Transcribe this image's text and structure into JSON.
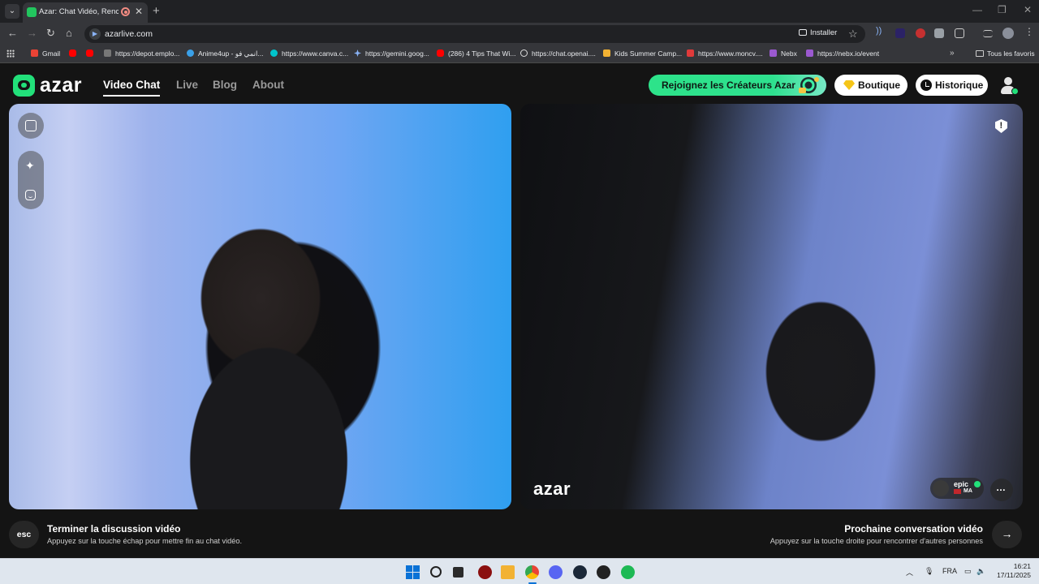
{
  "browser": {
    "tab_title": "Azar: Chat Vidéo, Rencontr",
    "tab_close": "✕",
    "new_tab": "+",
    "url": "azarlive.com",
    "install_label": "Installer",
    "bookmarks": [
      {
        "label": "Gmail",
        "icon_color": "#ea4335"
      },
      {
        "label": "",
        "icon_color": "#ff0000"
      },
      {
        "label": "",
        "icon_color": "#ff0000"
      },
      {
        "label": "https://depot.emplo...",
        "icon_color": "#777777"
      },
      {
        "label": "Anime4up - انمي فو...",
        "icon_color": "#3aa0e8"
      },
      {
        "label": "https://www.canva.c...",
        "icon_color": "#00c4cc"
      },
      {
        "label": "https://gemini.goog...",
        "icon_color": "#8ab4f8"
      },
      {
        "label": "(286) 4 Tips That Wi...",
        "icon_color": "#ff0000"
      },
      {
        "label": "https://chat.openai....",
        "icon_color": "#dddddd"
      },
      {
        "label": "Kids Summer Camp...",
        "icon_color": "#f2b233"
      },
      {
        "label": "https://www.moncv....",
        "icon_color": "#e03a3a"
      },
      {
        "label": "Nebx",
        "icon_color": "#9b59d0"
      },
      {
        "label": "https://nebx.io/event",
        "icon_color": "#9b59d0"
      }
    ],
    "bookmarks_more": "»",
    "all_bookmarks": "Tous les favoris"
  },
  "app": {
    "logo": "azar",
    "nav": [
      {
        "label": "Video Chat",
        "active": true
      },
      {
        "label": "Live",
        "active": false
      },
      {
        "label": "Blog",
        "active": false
      },
      {
        "label": "About",
        "active": false
      }
    ],
    "creators_label": "Rejoignez les Créateurs Azar",
    "boutique_label": "Boutique",
    "historique_label": "Historique",
    "watermark": "azar",
    "peer": {
      "name": "epic",
      "country": "MA"
    },
    "end_call": {
      "key": "esc",
      "title": "Terminer la discussion vidéo",
      "subtitle": "Appuyez sur la touche échap pour mettre fin au chat vidéo."
    },
    "next_call": {
      "title": "Prochaine conversation vidéo",
      "subtitle": "Appuyez sur la touche droite pour rencontrer d'autres personnes",
      "arrow": "→"
    },
    "icons": {
      "expand": "expand-icon",
      "effects": "sparkle-icon",
      "filters": "face-icon",
      "report": "report-icon",
      "chat": "chat-bubble-icon"
    }
  },
  "taskbar": {
    "language": "FRA",
    "time": "16:21",
    "date": "17/11/2025"
  },
  "colors": {
    "brand_green": "#22e07a",
    "background": "#141414"
  }
}
